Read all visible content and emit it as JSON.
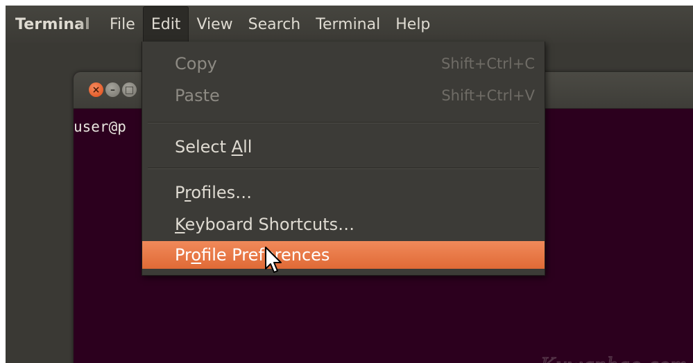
{
  "menubar": {
    "app_title": "Terminal",
    "menus": [
      "File",
      "Edit",
      "View",
      "Search",
      "Terminal",
      "Help"
    ]
  },
  "terminal": {
    "window_buttons": [
      "close-icon",
      "minimize-icon",
      "maximize-icon"
    ],
    "prompt_text": "user@p"
  },
  "edit_menu": {
    "copy": {
      "label": "Copy",
      "shortcut": "Shift+Ctrl+C"
    },
    "paste": {
      "label": "Paste",
      "shortcut": "Shift+Ctrl+V"
    },
    "select_all": {
      "before": "Select ",
      "mnemonic": "A",
      "after": "ll"
    },
    "profiles": {
      "before": "P",
      "mnemonic": "r",
      "after": "ofiles…"
    },
    "keyboard_shortcuts": {
      "before": "",
      "mnemonic": "K",
      "after": "eyboard Shortcuts…"
    },
    "profile_preferences": {
      "before": "Pr",
      "mnemonic": "o",
      "after": "file Preferences"
    }
  },
  "watermark": "Kuwanbao.com",
  "colors": {
    "highlight": "#e8773f",
    "terminal_bg": "#2c001e",
    "menu_bg": "#3c3b37"
  }
}
